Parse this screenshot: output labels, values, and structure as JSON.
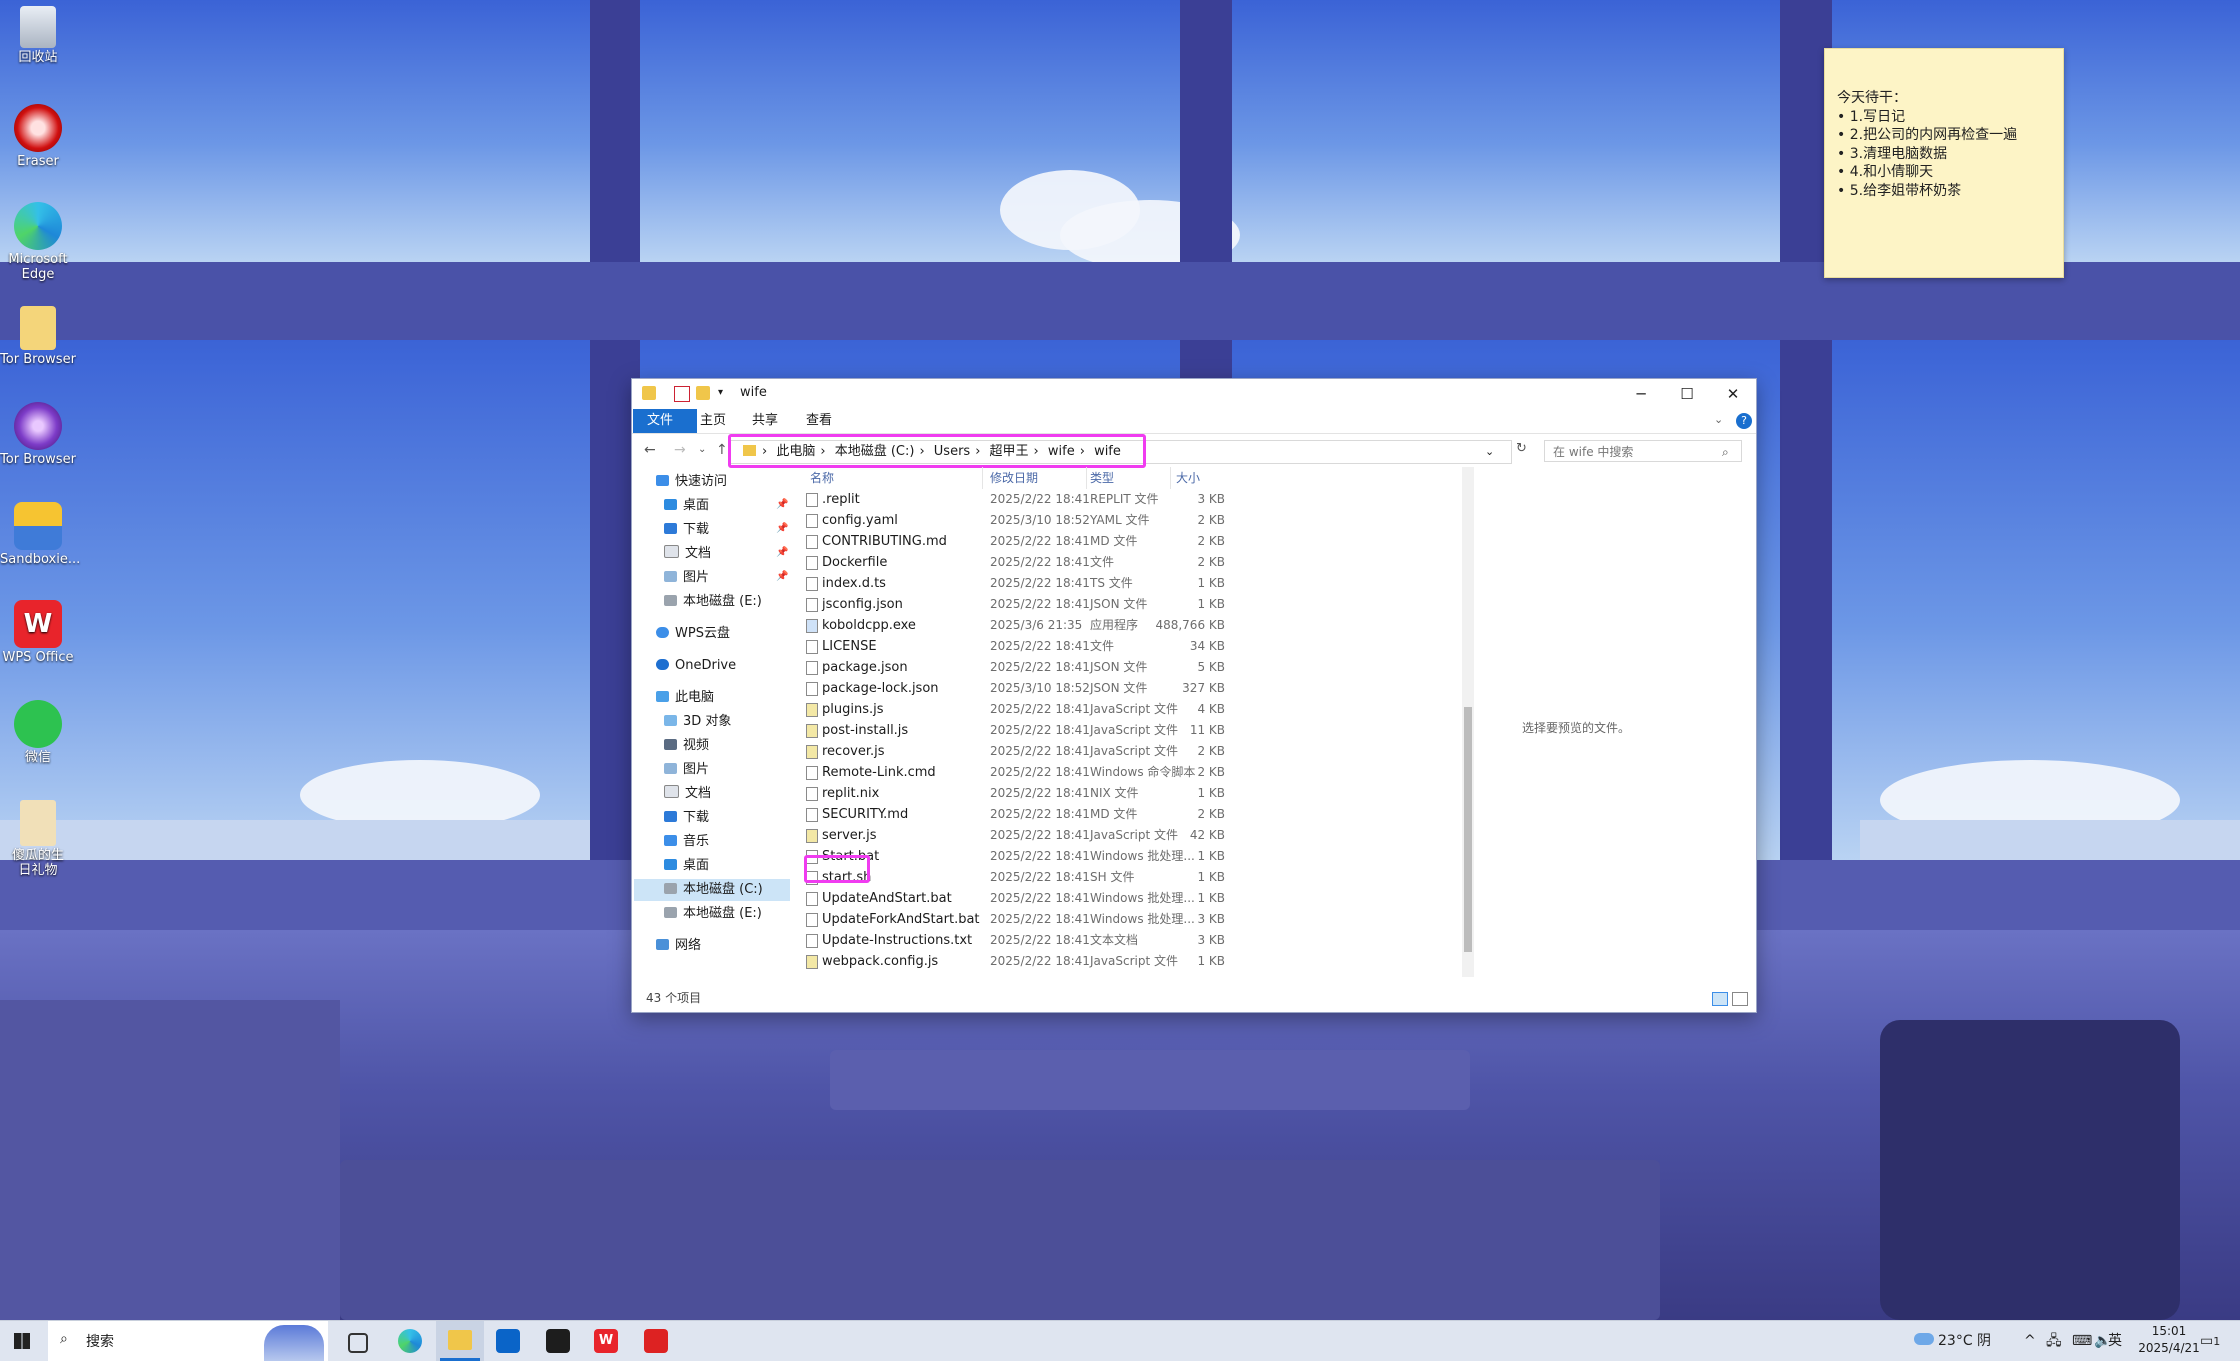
{
  "desktop_icons": [
    {
      "label": "回收站",
      "icon": "recycle-bin-icon"
    },
    {
      "label": "Eraser",
      "icon": "eraser-app-icon"
    },
    {
      "label": "Microsoft Edge",
      "icon": "edge-browser-icon"
    },
    {
      "label": "Tor Browser",
      "icon": "tor-browser-icon"
    },
    {
      "label": "Tor Browser",
      "icon": "tor-browser-icon"
    },
    {
      "label": "Sandboxie...",
      "icon": "sandboxie-icon"
    },
    {
      "label": "WPS Office",
      "icon": "wps-office-icon"
    },
    {
      "label": "微信",
      "icon": "wechat-icon"
    },
    {
      "label": "傻瓜的生日礼物",
      "icon": "folder-file-icon"
    }
  ],
  "sticky_note": {
    "lines": [
      "今天待干：",
      "• 1.写日记",
      "• 2.把公司的内网再检查一遍",
      "• 3.清理电脑数据",
      "• 4.和小倩聊天",
      "• 5.给李姐带杯奶茶"
    ]
  },
  "explorer": {
    "title": "wife",
    "ribbon_tabs": [
      "文件",
      "主页",
      "共享",
      "查看"
    ],
    "breadcrumbs": [
      "此电脑",
      "本地磁盘 (C:)",
      "Users",
      "超甲王",
      "wife",
      "wife"
    ],
    "search_placeholder": "在 wife 中搜索",
    "nav_items": [
      {
        "label": "快速访问",
        "icon": "star-icon"
      },
      {
        "label": "桌面",
        "icon": "desktop-icon"
      },
      {
        "label": "下载",
        "icon": "download-icon"
      },
      {
        "label": "文档",
        "icon": "document-icon"
      },
      {
        "label": "图片",
        "icon": "pictures-icon"
      },
      {
        "label": "本地磁盘 (E:)",
        "icon": "drive-icon"
      },
      {
        "label": "WPS云盘",
        "icon": "cloud-icon"
      },
      {
        "label": "OneDrive",
        "icon": "onedrive-icon"
      },
      {
        "label": "此电脑",
        "icon": "computer-icon"
      },
      {
        "label": "3D 对象",
        "icon": "3d-objects-icon"
      },
      {
        "label": "视频",
        "icon": "video-icon"
      },
      {
        "label": "图片",
        "icon": "pictures-icon"
      },
      {
        "label": "文档",
        "icon": "document-icon"
      },
      {
        "label": "下载",
        "icon": "download-icon"
      },
      {
        "label": "音乐",
        "icon": "music-icon"
      },
      {
        "label": "桌面",
        "icon": "desktop-icon"
      },
      {
        "label": "本地磁盘 (C:)",
        "icon": "drive-icon"
      },
      {
        "label": "本地磁盘 (E:)",
        "icon": "drive-icon"
      },
      {
        "label": "网络",
        "icon": "network-icon"
      }
    ],
    "columns": [
      "名称",
      "修改日期",
      "类型",
      "大小"
    ],
    "files": [
      {
        "name": ".replit",
        "date": "2025/2/22 18:41",
        "type": "REPLIT 文件",
        "size": "3 KB"
      },
      {
        "name": "config.yaml",
        "date": "2025/3/10 18:52",
        "type": "YAML 文件",
        "size": "2 KB"
      },
      {
        "name": "CONTRIBUTING.md",
        "date": "2025/2/22 18:41",
        "type": "MD 文件",
        "size": "2 KB"
      },
      {
        "name": "Dockerfile",
        "date": "2025/2/22 18:41",
        "type": "文件",
        "size": "2 KB"
      },
      {
        "name": "index.d.ts",
        "date": "2025/2/22 18:41",
        "type": "TS 文件",
        "size": "1 KB"
      },
      {
        "name": "jsconfig.json",
        "date": "2025/2/22 18:41",
        "type": "JSON 文件",
        "size": "1 KB"
      },
      {
        "name": "koboldcpp.exe",
        "date": "2025/3/6 21:35",
        "type": "应用程序",
        "size": "488,766 KB"
      },
      {
        "name": "LICENSE",
        "date": "2025/2/22 18:41",
        "type": "文件",
        "size": "34 KB"
      },
      {
        "name": "package.json",
        "date": "2025/2/22 18:41",
        "type": "JSON 文件",
        "size": "5 KB"
      },
      {
        "name": "package-lock.json",
        "date": "2025/3/10 18:52",
        "type": "JSON 文件",
        "size": "327 KB"
      },
      {
        "name": "plugins.js",
        "date": "2025/2/22 18:41",
        "type": "JavaScript 文件",
        "size": "4 KB"
      },
      {
        "name": "post-install.js",
        "date": "2025/2/22 18:41",
        "type": "JavaScript 文件",
        "size": "11 KB"
      },
      {
        "name": "recover.js",
        "date": "2025/2/22 18:41",
        "type": "JavaScript 文件",
        "size": "2 KB"
      },
      {
        "name": "Remote-Link.cmd",
        "date": "2025/2/22 18:41",
        "type": "Windows 命令脚本",
        "size": "2 KB"
      },
      {
        "name": "replit.nix",
        "date": "2025/2/22 18:41",
        "type": "NIX 文件",
        "size": "1 KB"
      },
      {
        "name": "SECURITY.md",
        "date": "2025/2/22 18:41",
        "type": "MD 文件",
        "size": "2 KB"
      },
      {
        "name": "server.js",
        "date": "2025/2/22 18:41",
        "type": "JavaScript 文件",
        "size": "42 KB"
      },
      {
        "name": "Start.bat",
        "date": "2025/2/22 18:41",
        "type": "Windows 批处理...",
        "size": "1 KB"
      },
      {
        "name": "start.sh",
        "date": "2025/2/22 18:41",
        "type": "SH 文件",
        "size": "1 KB"
      },
      {
        "name": "UpdateAndStart.bat",
        "date": "2025/2/22 18:41",
        "type": "Windows 批处理...",
        "size": "1 KB"
      },
      {
        "name": "UpdateForkAndStart.bat",
        "date": "2025/2/22 18:41",
        "type": "Windows 批处理...",
        "size": "3 KB"
      },
      {
        "name": "Update-Instructions.txt",
        "date": "2025/2/22 18:41",
        "type": "文本文档",
        "size": "3 KB"
      },
      {
        "name": "webpack.config.js",
        "date": "2025/2/22 18:41",
        "type": "JavaScript 文件",
        "size": "1 KB"
      }
    ],
    "preview_text": "选择要预览的文件。",
    "status_text": "43 个项目"
  },
  "taskbar": {
    "search_placeholder": "搜索",
    "weather": "23°C 阴",
    "ime": "英",
    "time": "15:01",
    "date": "2025/4/21",
    "notification_count": "1"
  },
  "colors": {
    "highlight": "#f03cf0",
    "accent": "#1a6fcf"
  }
}
